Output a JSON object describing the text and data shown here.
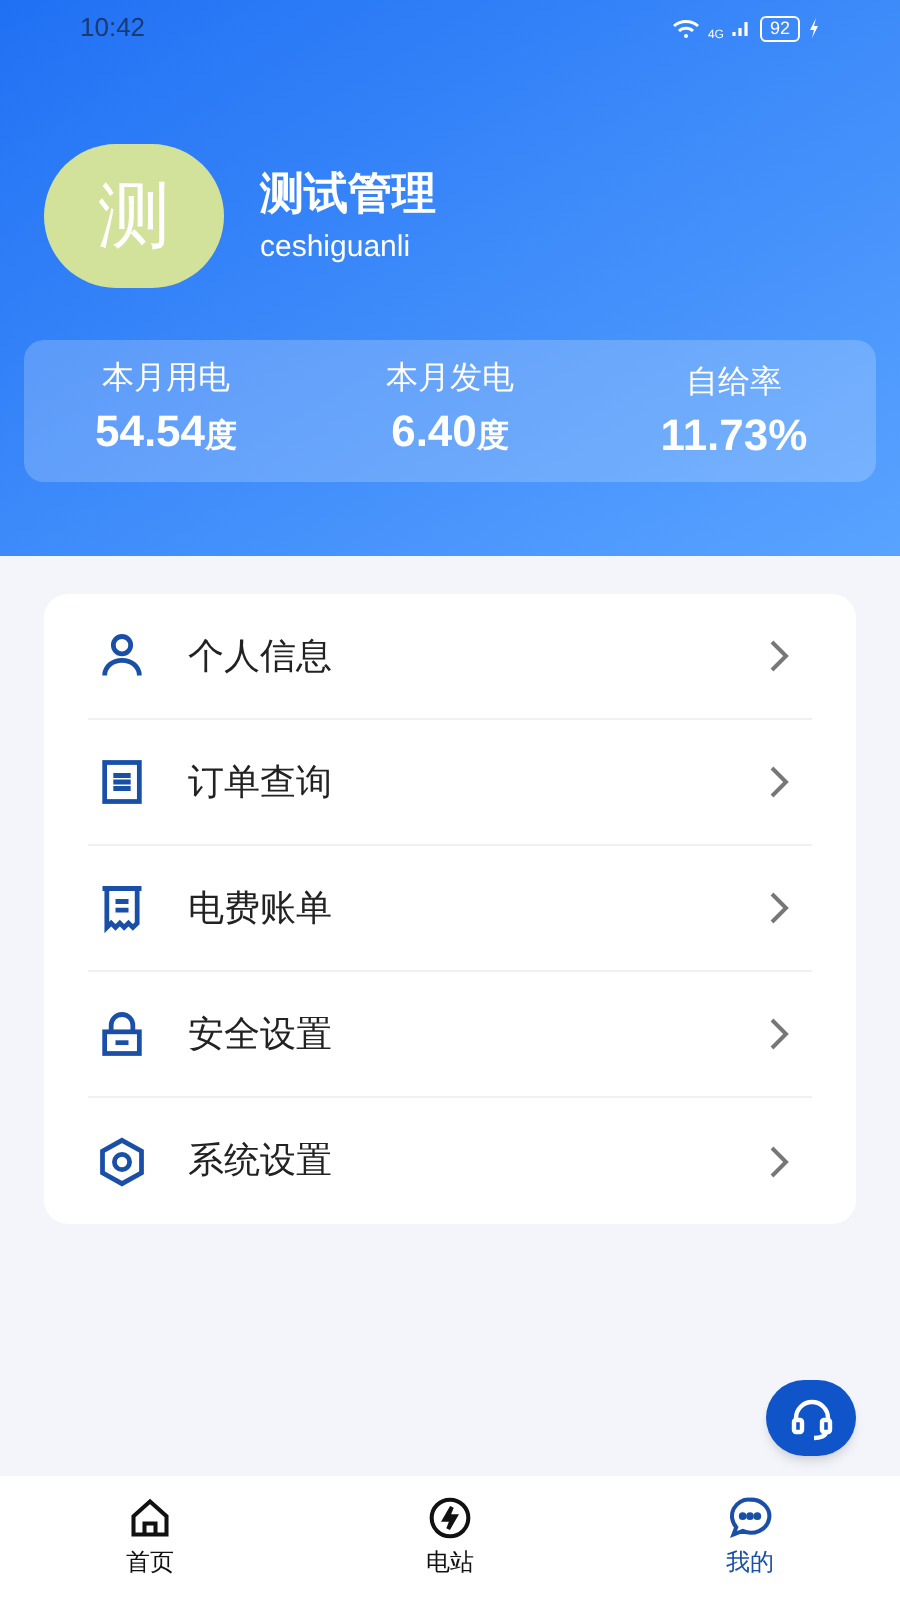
{
  "status_bar": {
    "time": "10:42",
    "network": "4G",
    "battery": "92"
  },
  "profile": {
    "avatar_text": "测",
    "name": "测试管理",
    "username": "ceshiguanli"
  },
  "stats": [
    {
      "label": "本月用电",
      "value": "54.54",
      "unit": "度"
    },
    {
      "label": "本月发电",
      "value": "6.40",
      "unit": "度"
    },
    {
      "label": "自给率",
      "value": "11.73%"
    }
  ],
  "menu": [
    {
      "kind": "person",
      "label": "个人信息"
    },
    {
      "kind": "list",
      "label": "订单查询"
    },
    {
      "kind": "receipt",
      "label": "电费账单"
    },
    {
      "kind": "lock",
      "label": "安全设置"
    },
    {
      "kind": "hex",
      "label": "系统设置"
    }
  ],
  "tabs": [
    {
      "kind": "home",
      "label": "首页",
      "selected": false
    },
    {
      "kind": "bolt",
      "label": "电站",
      "selected": false
    },
    {
      "kind": "chat",
      "label": "我的",
      "selected": true
    }
  ]
}
